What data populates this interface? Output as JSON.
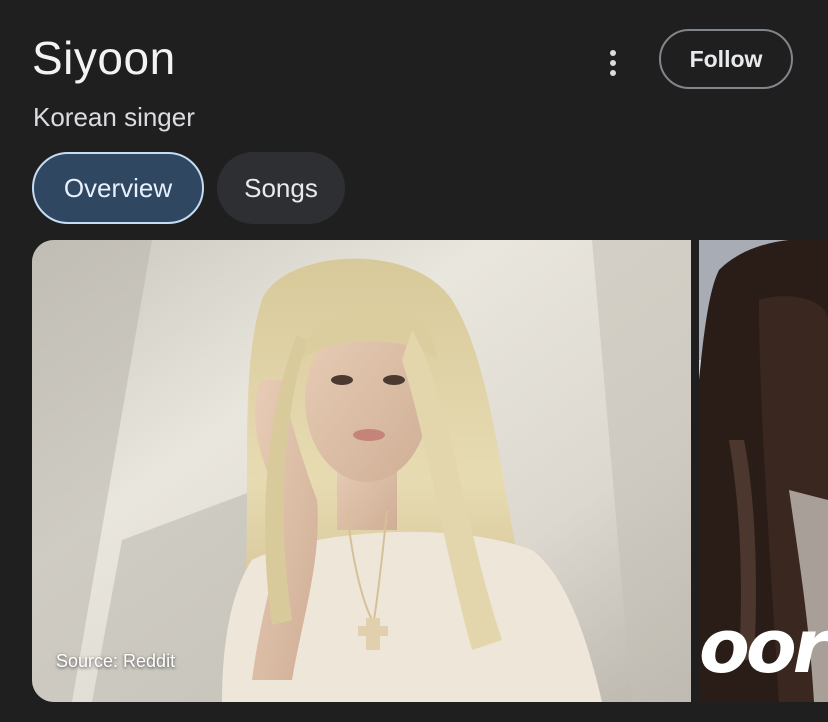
{
  "header": {
    "title": "Siyoon",
    "subtitle": "Korean singer",
    "follow_label": "Follow"
  },
  "tabs": [
    {
      "label": "Overview",
      "active": true
    },
    {
      "label": "Songs",
      "active": false
    }
  ],
  "images": {
    "main_source": "Source: Reddit",
    "second_overlay": "oor"
  },
  "icons": {
    "more": "more-vert-icon"
  },
  "colors": {
    "background": "#1f1f20",
    "tab_active_bg": "#2f4760",
    "tab_active_border": "#c6dcf2",
    "tab_inactive_bg": "#2d2f32",
    "follow_border": "#80868b"
  }
}
